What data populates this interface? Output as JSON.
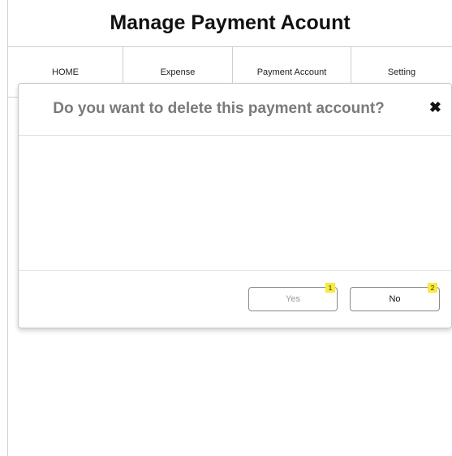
{
  "header": {
    "title": "Manage Payment Acount"
  },
  "nav": {
    "items": [
      {
        "label": "HOME"
      },
      {
        "label": "Expense"
      },
      {
        "label": "Payment Account"
      },
      {
        "label": "Setting"
      }
    ]
  },
  "dialog": {
    "title": "Do you want to delete this payment account?",
    "close_icon": "✖",
    "yes_label": "Yes",
    "yes_badge": "1",
    "no_label": "No",
    "no_badge": "2"
  }
}
